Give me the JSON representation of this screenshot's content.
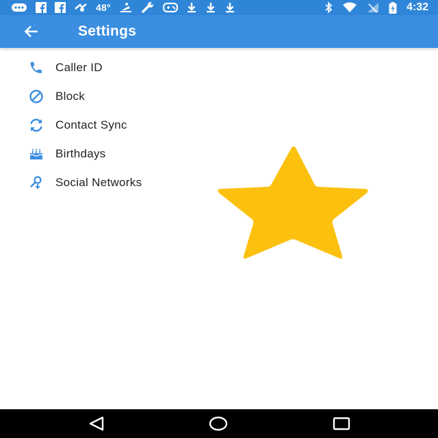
{
  "status_bar": {
    "temperature": "48°",
    "time": "4:32",
    "icons": [
      "messages-icon",
      "facebook-icon",
      "facebook-icon",
      "weather-icon",
      "sled-icon",
      "wrench-icon",
      "game-controller-icon",
      "download-icon",
      "download-icon",
      "download-icon",
      "bluetooth-icon",
      "wifi-icon",
      "signal-off-icon",
      "battery-charging-icon"
    ]
  },
  "app_bar": {
    "title": "Settings",
    "back_icon": "arrow-left-icon"
  },
  "settings": {
    "items": [
      {
        "label": "Caller ID",
        "icon": "phone-icon"
      },
      {
        "label": "Block",
        "icon": "block-icon"
      },
      {
        "label": "Contact Sync",
        "icon": "sync-icon"
      },
      {
        "label": "Birthdays",
        "icon": "cake-icon"
      },
      {
        "label": "Social Networks",
        "icon": "social-person-icon"
      }
    ]
  },
  "overlay": {
    "icon": "star-icon",
    "color": "#fcc10f"
  },
  "nav_bar": {
    "icons": [
      "back-triangle-icon",
      "home-circle-icon",
      "recents-square-icon"
    ]
  },
  "colors": {
    "status_bar": "#2f86d8",
    "app_bar": "#3b8ee0",
    "accent_icon": "#3b8ee0",
    "text": "#222222"
  }
}
